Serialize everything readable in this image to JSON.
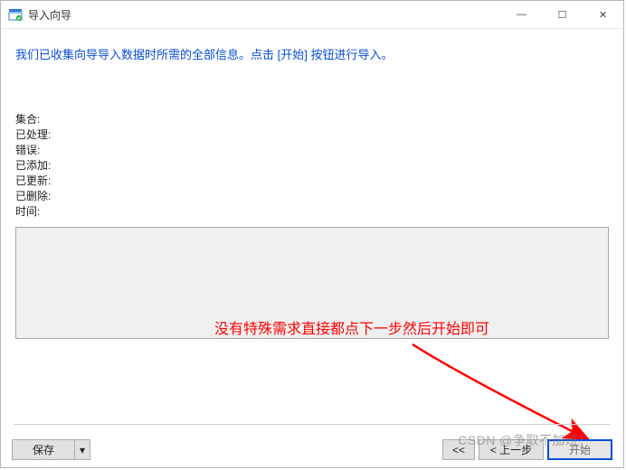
{
  "window": {
    "title": "导入向导"
  },
  "instruction": "我们已收集向导导入数据时所需的全部信息。点击 [开始] 按钮进行导入。",
  "fields": {
    "collection": {
      "label": "集合:",
      "value": ""
    },
    "processed": {
      "label": "已处理:",
      "value": ""
    },
    "errors": {
      "label": "错误:",
      "value": ""
    },
    "added": {
      "label": "已添加:",
      "value": ""
    },
    "updated": {
      "label": "已更新:",
      "value": ""
    },
    "deleted": {
      "label": "已删除:",
      "value": ""
    },
    "time": {
      "label": "时间:",
      "value": ""
    }
  },
  "annotation": "没有特殊需求直接都点下一步然后开始即可",
  "buttons": {
    "save": "保存",
    "first": "<<",
    "back": "< 上一步",
    "start": "开始"
  },
  "watermark": "CSDN @争取不加班！",
  "win_controls": {
    "minimize": "—",
    "maximize": "☐",
    "close": "✕"
  },
  "glyphs": {
    "dropdown": "▾"
  }
}
